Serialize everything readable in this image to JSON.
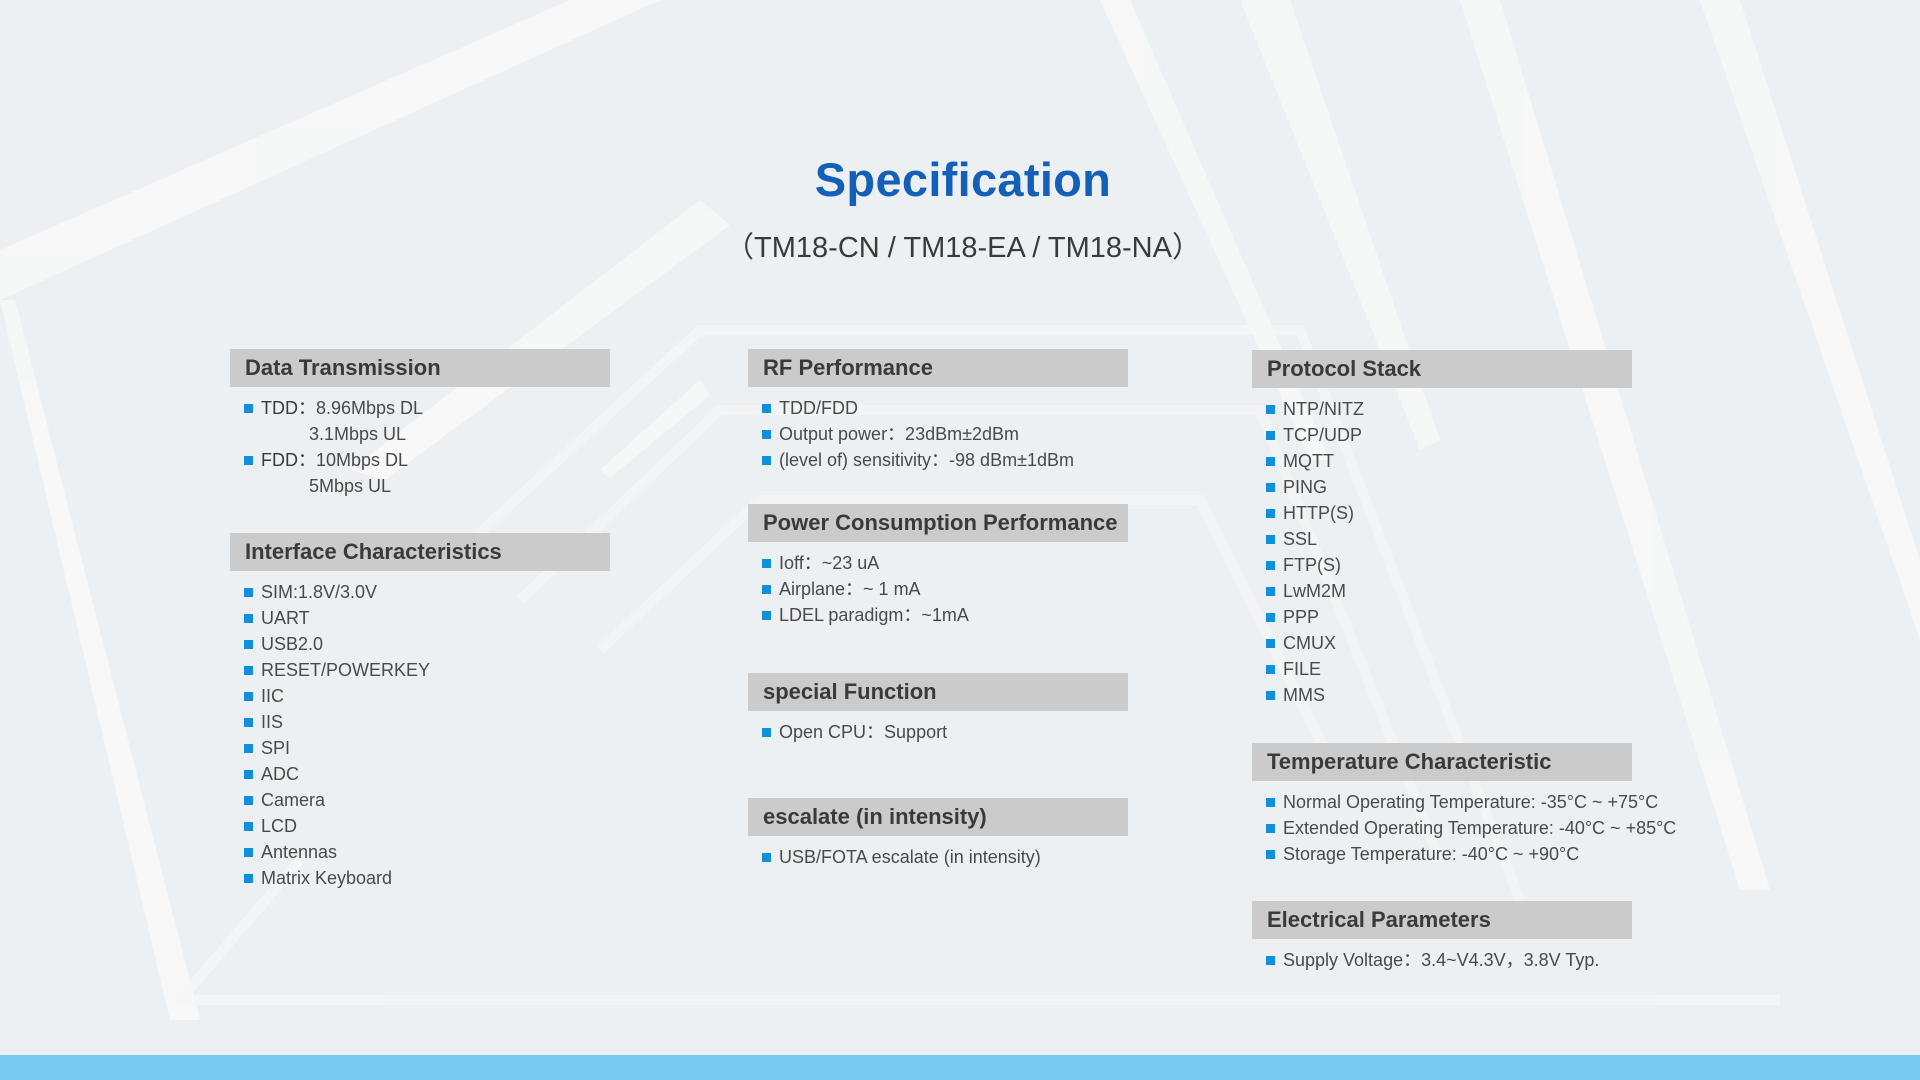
{
  "header": {
    "title": "Specification",
    "subtitle": "（TM18-CN / TM18-EA / TM18-NA）"
  },
  "colors": {
    "title": "#1460b8",
    "section_header_bg": "#cbcbcb",
    "bullet": "#0f8fdc",
    "background": "#edf0f3",
    "bottom_bar": "#78caf1"
  },
  "sections": {
    "data_transmission": {
      "title": "Data Transmission",
      "items": [
        {
          "key": "TDD：",
          "value": "8.96Mbps DL",
          "continuation": "3.1Mbps UL"
        },
        {
          "key": "FDD：",
          "value": "10Mbps DL",
          "continuation": "5Mbps UL"
        }
      ]
    },
    "interface": {
      "title": "Interface Characteristics",
      "items": [
        "SIM:1.8V/3.0V",
        "UART",
        "USB2.0",
        "RESET/POWERKEY",
        "IIC",
        "IIS",
        "SPI",
        "ADC",
        "Camera",
        "LCD",
        "Antennas",
        "Matrix Keyboard"
      ]
    },
    "rf": {
      "title": "RF Performance",
      "items": [
        "TDD/FDD",
        "Output power：23dBm±2dBm",
        "(level of) sensitivity：-98 dBm±1dBm"
      ]
    },
    "power": {
      "title": "Power Consumption Performance",
      "items": [
        "Ioff：~23 uA",
        "Airplane：~ 1 mA",
        "LDEL paradigm：~1mA"
      ]
    },
    "special": {
      "title": "special Function",
      "items": [
        "Open CPU：Support"
      ]
    },
    "escalate": {
      "title": "escalate (in intensity)",
      "items": [
        "USB/FOTA escalate (in intensity)"
      ]
    },
    "protocol": {
      "title": "Protocol Stack",
      "items": [
        "NTP/NITZ",
        "TCP/UDP",
        "MQTT",
        "PING",
        "HTTP(S)",
        "SSL",
        "FTP(S)",
        "LwM2M",
        "PPP",
        "CMUX",
        "FILE",
        "MMS"
      ]
    },
    "temperature": {
      "title": "Temperature Characteristic",
      "items": [
        "Normal Operating Temperature: -35°C ~ +75°C",
        "Extended Operating Temperature: -40°C ~ +85°C",
        "Storage Temperature: -40°C ~ +90°C"
      ]
    },
    "electrical": {
      "title": "Electrical Parameters",
      "items": [
        "Supply Voltage：3.4~V4.3V，3.8V Typ."
      ]
    }
  }
}
